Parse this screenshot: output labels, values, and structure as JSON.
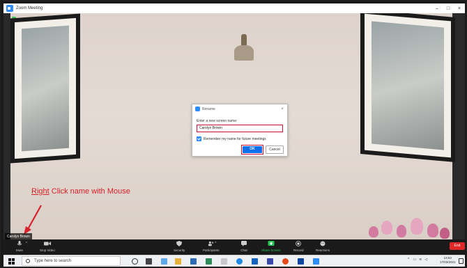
{
  "window": {
    "title": "Zoom Meeting",
    "controls": [
      "–",
      "□",
      "×"
    ]
  },
  "dialog": {
    "title": "Rename",
    "close": "×",
    "prompt": "Enter a new screen name:",
    "input_value": "Carolyn Brown",
    "remember_label": "Remember my name for future meetings",
    "remember_checked": true,
    "ok_label": "OK",
    "cancel_label": "Cancel"
  },
  "annotation": {
    "emphasis": "Right",
    "rest": " Click name with Mouse",
    "color": "#d6202a"
  },
  "participant": {
    "name_tag": "Carolyn Brown"
  },
  "toolbar": {
    "mute": "Mute",
    "stop_video": "Stop Video",
    "security": "Security",
    "participants": "Participants",
    "participants_count": "1",
    "chat": "Chat",
    "share_screen": "Share Screen",
    "record": "Record",
    "reactions": "Reactions",
    "end": "End"
  },
  "taskbar": {
    "search_placeholder": "Type here to search",
    "time": "13:53",
    "date": "17/03/2021"
  },
  "colors": {
    "zoom_blue": "#2d8cff",
    "ok_blue": "#0e71eb",
    "highlight_red": "#c8102e",
    "end_red": "#e02828",
    "share_green": "#23c552"
  }
}
